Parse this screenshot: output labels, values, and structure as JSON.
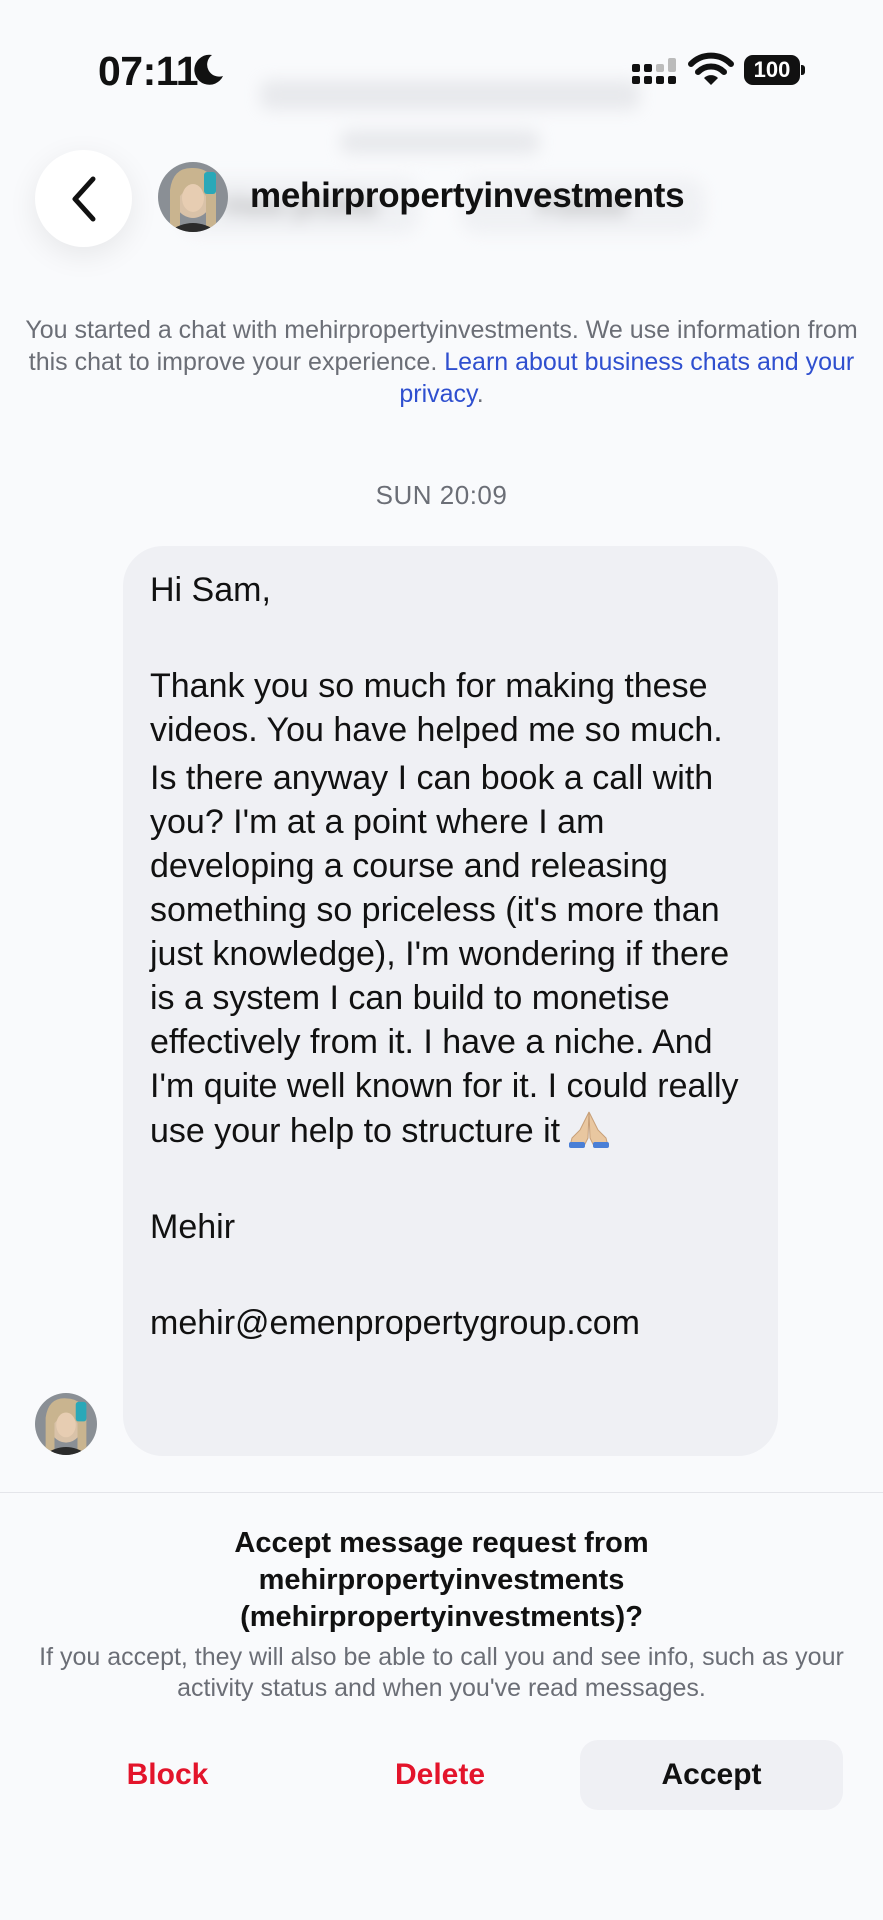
{
  "status_bar": {
    "time": "07:11",
    "battery": "100"
  },
  "header": {
    "username": "mehirpropertyinvestments"
  },
  "blurred_profile": {
    "view_profile": "View profile",
    "follow": "Follow"
  },
  "privacy_notice": {
    "text": "You started a chat with mehirpropertyinvestments. We use information from this chat to improve your experience. ",
    "link": "Learn about business chats and your privacy",
    "end": "."
  },
  "chat": {
    "timestamp": "SUN 20:09",
    "message": {
      "greeting": "Hi Sam,",
      "paragraph1": "Thank you so much for making these videos. You have helped me so much.",
      "paragraph2": "Is there anyway I can book a call with you? I'm at a point where I am developing a course and releasing something so priceless (it's more than just knowledge), I'm wondering if there is a system I can build to monetise effectively from it. I have a niche. And I'm quite well known for it. I could really use your help to structure it",
      "signature": "Mehir",
      "email": "mehir@emenpropertygroup.com"
    }
  },
  "request": {
    "title": "Accept message request from mehirpropertyinvestments (mehirpropertyinvestments)?",
    "description": "If you accept, they will also be able to call you and see info, such as your activity status and when you've read messages.",
    "block_label": "Block",
    "delete_label": "Delete",
    "accept_label": "Accept"
  },
  "colors": {
    "link": "#2f4fcf",
    "destructive": "#e3142b",
    "bubble": "#eff0f4"
  },
  "icons": [
    "moon-icon",
    "signal-icon",
    "wifi-icon",
    "battery-icon",
    "back-chevron-icon",
    "pray-emoji-icon"
  ]
}
